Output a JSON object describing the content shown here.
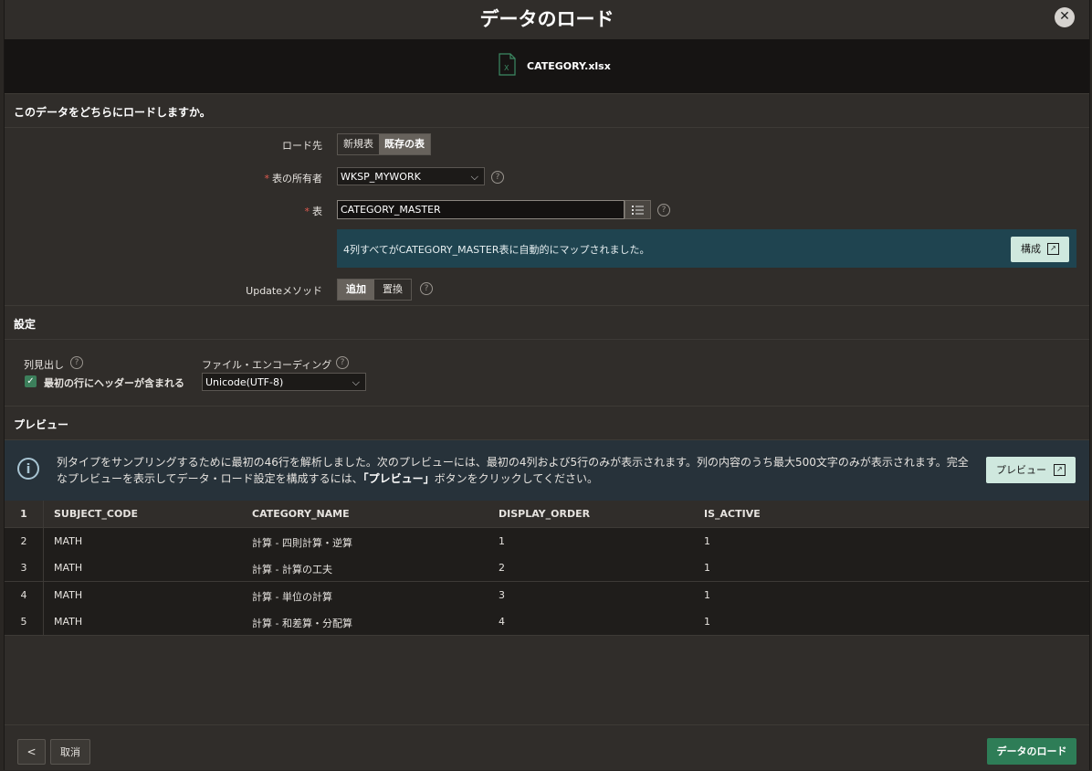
{
  "dialog": {
    "title": "データのロード",
    "file_name": "CATEGORY.xlsx"
  },
  "destination": {
    "section_title": "このデータをどちらにロードしますか。",
    "load_to_label": "ロード先",
    "load_to_options": [
      "新規表",
      "既存の表"
    ],
    "load_to_selected": "既存の表",
    "owner_label": "表の所有者",
    "owner_value": "WKSP_MYWORK",
    "table_label": "表",
    "table_value": "CATEGORY_MASTER",
    "mapping_message": "4列すべてがCATEGORY_MASTER表に自動的にマップされました。",
    "configure_label": "構成",
    "update_method_label": "Updateメソッド",
    "update_method_options": [
      "追加",
      "置換"
    ],
    "update_method_selected": "追加"
  },
  "settings": {
    "section_title": "設定",
    "column_header_label": "列見出し",
    "header_checkbox_label": "最初の行にヘッダーが含まれる",
    "header_checked": true,
    "encoding_label": "ファイル・エンコーディング",
    "encoding_value": "Unicode(UTF-8)"
  },
  "preview": {
    "section_title": "プレビュー",
    "info_text_1": "列タイプをサンプリングするために最初の46行を解析しました。次のプレビューには、最初の4列および5行のみが表示されます。列の内容のうち最大500文字のみが表示されます。完全なプレビューを表示してデータ・ロード設定を構成するには、",
    "info_text_bold": "「プレビュー」",
    "info_text_2": "ボタンをクリックしてください。",
    "preview_button_label": "プレビュー",
    "header_row_num": "1",
    "columns": [
      "SUBJECT_CODE",
      "CATEGORY_NAME",
      "DISPLAY_ORDER",
      "IS_ACTIVE"
    ],
    "rows": [
      {
        "num": "2",
        "cells": [
          "MATH",
          "計算 - 四則計算・逆算",
          "1",
          "1"
        ]
      },
      {
        "num": "3",
        "cells": [
          "MATH",
          "計算 - 計算の工夫",
          "2",
          "1"
        ]
      },
      {
        "num": "4",
        "cells": [
          "MATH",
          "計算 - 単位の計算",
          "3",
          "1"
        ]
      },
      {
        "num": "5",
        "cells": [
          "MATH",
          "計算 - 和差算・分配算",
          "4",
          "1"
        ]
      }
    ]
  },
  "footer": {
    "back_icon": "chevron-left-icon",
    "cancel_label": "取消",
    "load_label": "データのロード"
  }
}
